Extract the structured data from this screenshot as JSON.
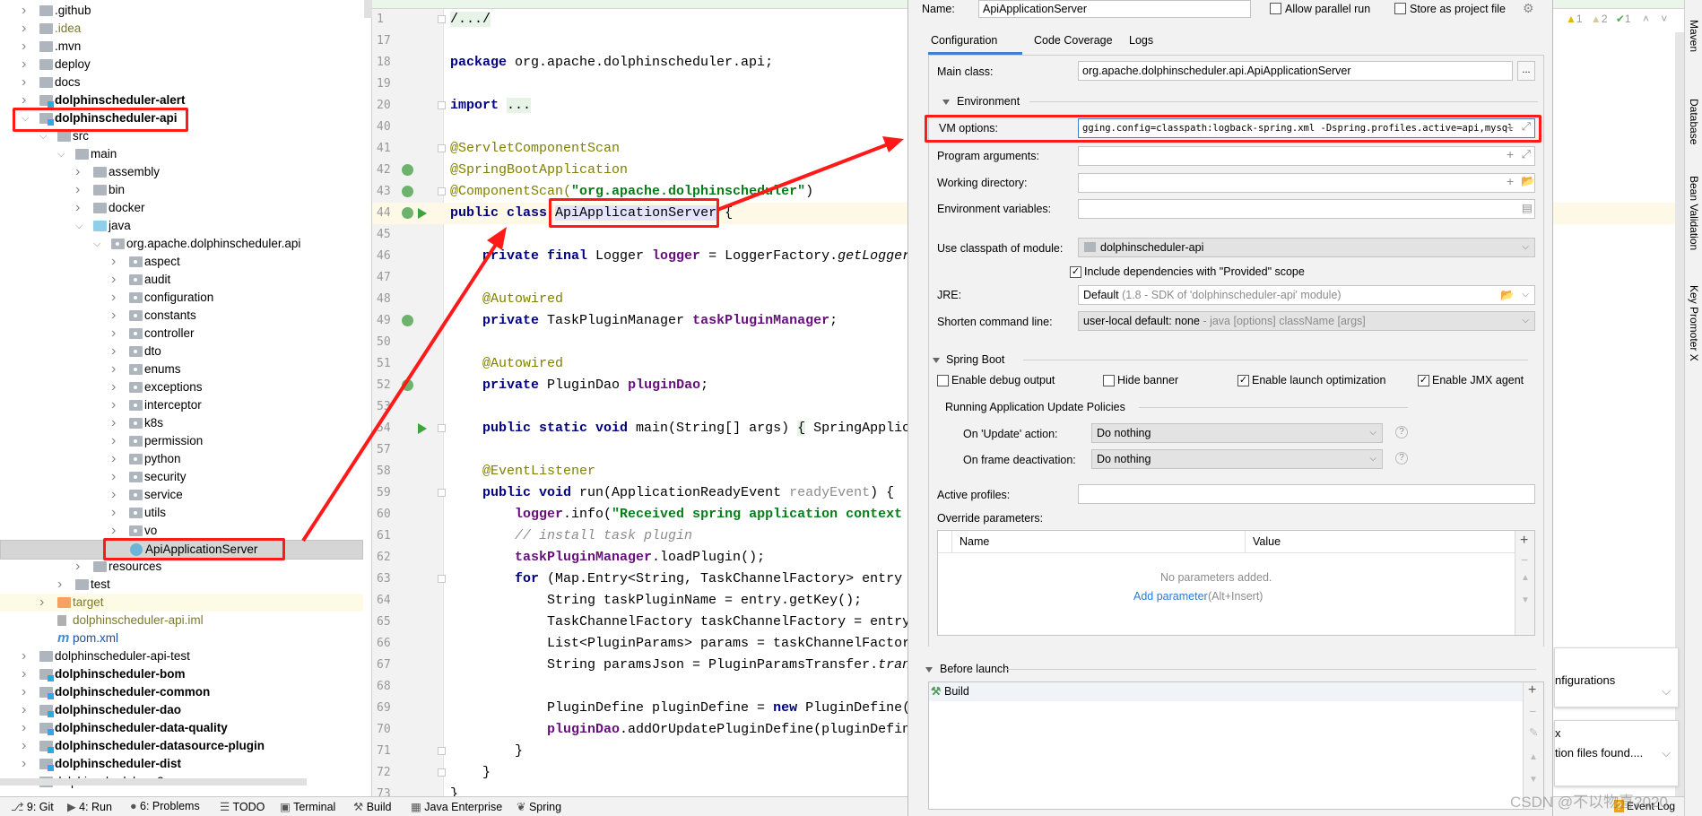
{
  "tree": {
    "items": [
      {
        "label": ".github",
        "level": 0,
        "arrow": "right",
        "icon": "folder"
      },
      {
        "label": ".idea",
        "level": 0,
        "arrow": "right",
        "icon": "folder",
        "style": "olive"
      },
      {
        "label": ".mvn",
        "level": 0,
        "arrow": "right",
        "icon": "folder"
      },
      {
        "label": "deploy",
        "level": 0,
        "arrow": "right",
        "icon": "folder"
      },
      {
        "label": "docs",
        "level": 0,
        "arrow": "right",
        "icon": "folder"
      },
      {
        "label": "dolphinscheduler-alert",
        "level": 0,
        "arrow": "right",
        "icon": "module",
        "style": "bold"
      },
      {
        "label": "dolphinscheduler-api",
        "level": 0,
        "arrow": "down",
        "icon": "module",
        "style": "bold"
      },
      {
        "label": "src",
        "level": 1,
        "arrow": "down",
        "icon": "folder"
      },
      {
        "label": "main",
        "level": 2,
        "arrow": "down",
        "icon": "folder"
      },
      {
        "label": "assembly",
        "level": 3,
        "arrow": "right",
        "icon": "folder"
      },
      {
        "label": "bin",
        "level": 3,
        "arrow": "right",
        "icon": "folder"
      },
      {
        "label": "docker",
        "level": 3,
        "arrow": "right",
        "icon": "folder"
      },
      {
        "label": "java",
        "level": 3,
        "arrow": "down",
        "icon": "source"
      },
      {
        "label": "org.apache.dolphinscheduler.api",
        "level": 4,
        "arrow": "down",
        "icon": "package"
      },
      {
        "label": "aspect",
        "level": 5,
        "arrow": "right",
        "icon": "package"
      },
      {
        "label": "audit",
        "level": 5,
        "arrow": "right",
        "icon": "package"
      },
      {
        "label": "configuration",
        "level": 5,
        "arrow": "right",
        "icon": "package"
      },
      {
        "label": "constants",
        "level": 5,
        "arrow": "right",
        "icon": "package"
      },
      {
        "label": "controller",
        "level": 5,
        "arrow": "right",
        "icon": "package"
      },
      {
        "label": "dto",
        "level": 5,
        "arrow": "right",
        "icon": "package"
      },
      {
        "label": "enums",
        "level": 5,
        "arrow": "right",
        "icon": "package"
      },
      {
        "label": "exceptions",
        "level": 5,
        "arrow": "right",
        "icon": "package"
      },
      {
        "label": "interceptor",
        "level": 5,
        "arrow": "right",
        "icon": "package"
      },
      {
        "label": "k8s",
        "level": 5,
        "arrow": "right",
        "icon": "package"
      },
      {
        "label": "permission",
        "level": 5,
        "arrow": "right",
        "icon": "package"
      },
      {
        "label": "python",
        "level": 5,
        "arrow": "right",
        "icon": "package"
      },
      {
        "label": "security",
        "level": 5,
        "arrow": "right",
        "icon": "package"
      },
      {
        "label": "service",
        "level": 5,
        "arrow": "right",
        "icon": "package"
      },
      {
        "label": "utils",
        "level": 5,
        "arrow": "right",
        "icon": "package"
      },
      {
        "label": "vo",
        "level": 5,
        "arrow": "right",
        "icon": "package"
      },
      {
        "label": "ApiApplicationServer",
        "level": 5,
        "arrow": "none",
        "icon": "class",
        "selected": true
      },
      {
        "label": "resources",
        "level": 3,
        "arrow": "right",
        "icon": "folder"
      },
      {
        "label": "test",
        "level": 2,
        "arrow": "right",
        "icon": "folder"
      },
      {
        "label": "target",
        "level": 1,
        "arrow": "right",
        "icon": "excluded",
        "style": "olive",
        "excluded": true
      },
      {
        "label": "dolphinscheduler-api.iml",
        "level": 1,
        "arrow": "none",
        "icon": "iml",
        "style": "olive"
      },
      {
        "label": "pom.xml",
        "level": 1,
        "arrow": "none",
        "icon": "maven",
        "style": "blue"
      },
      {
        "label": "dolphinscheduler-api-test",
        "level": 0,
        "arrow": "right",
        "icon": "folder"
      },
      {
        "label": "dolphinscheduler-bom",
        "level": 0,
        "arrow": "right",
        "icon": "module",
        "style": "bold"
      },
      {
        "label": "dolphinscheduler-common",
        "level": 0,
        "arrow": "right",
        "icon": "module",
        "style": "bold"
      },
      {
        "label": "dolphinscheduler-dao",
        "level": 0,
        "arrow": "right",
        "icon": "module",
        "style": "bold"
      },
      {
        "label": "dolphinscheduler-data-quality",
        "level": 0,
        "arrow": "right",
        "icon": "module",
        "style": "bold"
      },
      {
        "label": "dolphinscheduler-datasource-plugin",
        "level": 0,
        "arrow": "right",
        "icon": "module",
        "style": "bold"
      },
      {
        "label": "dolphinscheduler-dist",
        "level": 0,
        "arrow": "right",
        "icon": "module",
        "style": "bold"
      },
      {
        "label": "dolphinscheduler-e2e",
        "level": 0,
        "arrow": "right",
        "icon": "folder"
      }
    ]
  },
  "editor": {
    "lines": [
      {
        "n": "1",
        "fold": true,
        "t": [
          [
            "/.../",
            "fold"
          ]
        ]
      },
      {
        "n": "17",
        "t": []
      },
      {
        "n": "18",
        "t": [
          [
            "package",
            "kw"
          ],
          [
            " org.apache.dolphinscheduler.api;",
            ""
          ]
        ]
      },
      {
        "n": "19",
        "t": []
      },
      {
        "n": "20",
        "fold": true,
        "t": [
          [
            "import",
            "kw"
          ],
          [
            " ",
            ""
          ],
          [
            "...",
            "fold"
          ]
        ]
      },
      {
        "n": "40",
        "t": []
      },
      {
        "n": "41",
        "fold": true,
        "t": [
          [
            "@ServletComponentScan",
            "an"
          ]
        ]
      },
      {
        "n": "42",
        "bean": true,
        "t": [
          [
            "@SpringBootApplication",
            "an"
          ]
        ]
      },
      {
        "n": "43",
        "bean": true,
        "fold": true,
        "t": [
          [
            "@ComponentScan(",
            "an"
          ],
          [
            "\"org.apache.dolphinscheduler\"",
            "st"
          ],
          [
            ")",
            ""
          ]
        ]
      },
      {
        "n": "44",
        "bean": true,
        "run": true,
        "current": true,
        "t": [
          [
            "public class",
            "kw"
          ],
          [
            " ",
            ""
          ],
          [
            "ApiApplicationServer",
            "hl"
          ],
          [
            " {",
            ""
          ]
        ]
      },
      {
        "n": "45",
        "t": []
      },
      {
        "n": "46",
        "t": [
          [
            "    private final",
            "kw"
          ],
          [
            " Logger ",
            ""
          ],
          [
            "logger",
            "fd"
          ],
          [
            " = LoggerFactory.",
            ""
          ],
          [
            "getLogger",
            "it"
          ]
        ]
      },
      {
        "n": "47",
        "t": []
      },
      {
        "n": "48",
        "t": [
          [
            "    @Autowired",
            "an"
          ]
        ]
      },
      {
        "n": "49",
        "bean": true,
        "t": [
          [
            "    private",
            "kw"
          ],
          [
            " TaskPluginManager ",
            ""
          ],
          [
            "taskPluginManager",
            "fd"
          ],
          [
            ";",
            ""
          ]
        ]
      },
      {
        "n": "50",
        "t": []
      },
      {
        "n": "51",
        "t": [
          [
            "    @Autowired",
            "an"
          ]
        ]
      },
      {
        "n": "52",
        "bean": true,
        "t": [
          [
            "    private",
            "kw"
          ],
          [
            " PluginDao ",
            ""
          ],
          [
            "pluginDao",
            "fd"
          ],
          [
            ";",
            ""
          ]
        ]
      },
      {
        "n": "53",
        "t": []
      },
      {
        "n": "54",
        "run": true,
        "fold": true,
        "t": [
          [
            "    public static void",
            "kw"
          ],
          [
            " main(String[] args) ",
            ""
          ],
          [
            "{",
            "fold"
          ],
          [
            " SpringApplica",
            ""
          ]
        ]
      },
      {
        "n": "57",
        "t": []
      },
      {
        "n": "58",
        "t": [
          [
            "    @EventListener",
            "an"
          ]
        ]
      },
      {
        "n": "59",
        "fold": true,
        "t": [
          [
            "    public void",
            "kw"
          ],
          [
            " run(ApplicationReadyEvent ",
            ""
          ],
          [
            "readyEvent",
            "pr"
          ],
          [
            ") {",
            ""
          ]
        ]
      },
      {
        "n": "60",
        "t": [
          [
            "        ",
            ""
          ],
          [
            "logger",
            "fd"
          ],
          [
            ".info(",
            ""
          ],
          [
            "\"Received spring application context ",
            "st"
          ]
        ]
      },
      {
        "n": "61",
        "t": [
          [
            "        // install task plugin",
            "cm"
          ]
        ]
      },
      {
        "n": "62",
        "t": [
          [
            "        ",
            ""
          ],
          [
            "taskPluginManager",
            "fd"
          ],
          [
            ".loadPlugin();",
            ""
          ]
        ]
      },
      {
        "n": "63",
        "fold": true,
        "t": [
          [
            "        for",
            "kw"
          ],
          [
            " (Map.Entry<String, TaskChannelFactory> entry",
            ""
          ]
        ]
      },
      {
        "n": "64",
        "t": [
          [
            "            String taskPluginName = entry.getKey();",
            ""
          ]
        ]
      },
      {
        "n": "65",
        "t": [
          [
            "            TaskChannelFactory taskChannelFactory = entry",
            ""
          ]
        ]
      },
      {
        "n": "66",
        "t": [
          [
            "            List<PluginParams> params = taskChannelFactor",
            ""
          ]
        ]
      },
      {
        "n": "67",
        "t": [
          [
            "            String paramsJson = PluginParamsTransfer.",
            ""
          ],
          [
            "trans",
            "it"
          ]
        ]
      },
      {
        "n": "68",
        "t": []
      },
      {
        "n": "69",
        "t": [
          [
            "            PluginDefine pluginDefine = ",
            ""
          ],
          [
            "new",
            "kw"
          ],
          [
            " PluginDefine(",
            ""
          ]
        ]
      },
      {
        "n": "70",
        "t": [
          [
            "            ",
            ""
          ],
          [
            "pluginDao",
            "fd"
          ],
          [
            ".addOrUpdatePluginDefine(pluginDefin",
            ""
          ]
        ]
      },
      {
        "n": "71",
        "fold": true,
        "t": [
          [
            "        }",
            ""
          ]
        ]
      },
      {
        "n": "72",
        "fold": true,
        "t": [
          [
            "    }",
            ""
          ]
        ]
      },
      {
        "n": "73",
        "t": [
          [
            "}",
            ""
          ]
        ]
      }
    ],
    "inspections": {
      "errors": "1",
      "warnings": "2",
      "typos": "1"
    }
  },
  "bottom_bar": {
    "items": [
      {
        "label": "9: Git",
        "icon": "git-icon"
      },
      {
        "label": "4: Run",
        "icon": "run-icon"
      },
      {
        "label": "6: Problems",
        "icon": "problems-icon"
      },
      {
        "label": "TODO",
        "icon": "todo-icon"
      },
      {
        "label": "Terminal",
        "icon": "terminal-icon"
      },
      {
        "label": "Build",
        "icon": "hammer-icon"
      },
      {
        "label": "Java Enterprise",
        "icon": "java-enterprise-icon"
      },
      {
        "label": "Spring",
        "icon": "spring-icon"
      }
    ],
    "event_log": "Event Log"
  },
  "right_toolbar": [
    "Maven",
    "Database",
    "Bean Validation",
    "Key Promoter X"
  ],
  "background_tiles": [
    "nfigurations",
    "x",
    "tion files found...."
  ],
  "dialog": {
    "name_label": "Name:",
    "name_value": "ApiApplicationServer",
    "allow_parallel_run": {
      "label": "Allow parallel run",
      "checked": false
    },
    "store_as_project_file": {
      "label": "Store as project file",
      "checked": false
    },
    "tabs": [
      "Configuration",
      "Code Coverage",
      "Logs"
    ],
    "active_tab": "Configuration",
    "main_class_label": "Main class:",
    "main_class_value": "org.apache.dolphinscheduler.api.ApiApplicationServer",
    "browse_label": "...",
    "environment_header": "Environment",
    "vm_options_label": "VM options:",
    "vm_options_value": "gging.config=classpath:logback-spring.xml -Dspring.profiles.active=api,mysql",
    "program_arguments_label": "Program arguments:",
    "working_directory_label": "Working directory:",
    "environment_variables_label": "Environment variables:",
    "classpath_module_label": "Use classpath of module:",
    "classpath_module_value": "dolphinscheduler-api",
    "include_provided": {
      "label": "Include dependencies with \"Provided\" scope",
      "checked": true
    },
    "jre_label": "JRE:",
    "jre_value": "Default",
    "jre_hint": "(1.8 - SDK of 'dolphinscheduler-api' module)",
    "shorten_label": "Shorten command line:",
    "shorten_value": "user-local default: none",
    "shorten_hint": "- java [options] className [args]",
    "spring_boot_header": "Spring Boot",
    "checkboxes": [
      {
        "label": "Enable debug output",
        "checked": false
      },
      {
        "label": "Hide banner",
        "checked": false
      },
      {
        "label": "Enable launch optimization",
        "checked": true
      },
      {
        "label": "Enable JMX agent",
        "checked": true
      }
    ],
    "update_policies_header": "Running Application Update Policies",
    "on_update_label": "On 'Update' action:",
    "on_update_value": "Do nothing",
    "on_frame_label": "On frame deactivation:",
    "on_frame_value": "Do nothing",
    "active_profiles_label": "Active profiles:",
    "override_label": "Override parameters:",
    "table_columns": [
      "Name",
      "Value"
    ],
    "empty_text": "No parameters added.",
    "add_parameter": "Add parameter",
    "add_parameter_shortcut": "(Alt+Insert)",
    "before_launch_header": "Before launch",
    "before_launch_items": [
      "Build"
    ]
  },
  "watermark": "CSDN @不以物喜2020",
  "colors": {
    "annotation_red": "#ff1a1a",
    "accent": "#3d7fd1"
  }
}
